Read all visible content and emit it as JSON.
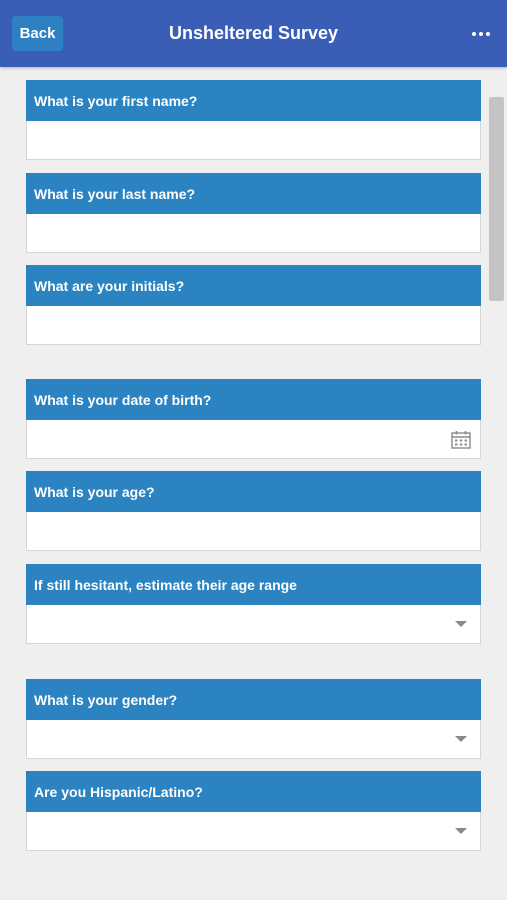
{
  "header": {
    "back_label": "Back",
    "title": "Unsheltered Survey",
    "more_icon": "more-horizontal-icon",
    "background": "#3a5db6"
  },
  "questions": [
    {
      "label": "What is your first name?",
      "type": "text",
      "value": ""
    },
    {
      "label": "What is your last name?",
      "type": "text",
      "value": ""
    },
    {
      "label": "What are your initials?",
      "type": "text",
      "value": ""
    },
    {
      "label": "What is your date of birth?",
      "type": "date",
      "value": "",
      "icon": "calendar-icon"
    },
    {
      "label": "What is your age?",
      "type": "text",
      "value": ""
    },
    {
      "label": "If still hesitant, estimate their age range",
      "type": "select",
      "value": ""
    },
    {
      "label": "What is your gender?",
      "type": "select",
      "value": ""
    },
    {
      "label": "Are you Hispanic/Latino?",
      "type": "select",
      "value": ""
    }
  ],
  "colors": {
    "label_background": "#2b83c1",
    "page_background": "#efefef"
  }
}
